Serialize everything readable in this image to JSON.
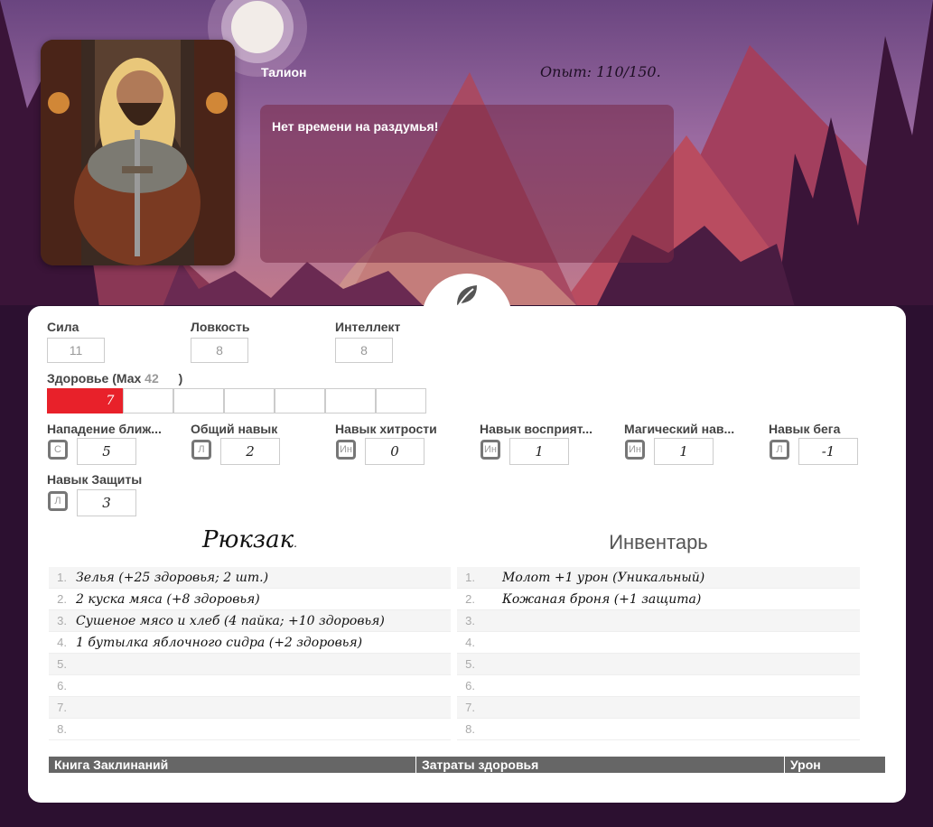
{
  "character": {
    "name": "Талион",
    "experience": "Опыт: 110/150.",
    "speech": "Нет времени на раздумья!"
  },
  "colors": {
    "health_fill": "#e8212a",
    "card_bg": "#ffffff",
    "spell_header_bg": "#666666"
  },
  "icons": {
    "toggle": "leaf-icon"
  },
  "stats": {
    "strength": {
      "label": "Сила",
      "value": "11"
    },
    "agility": {
      "label": "Ловкость",
      "value": "8"
    },
    "intellect": {
      "label": "Интеллект",
      "value": "8"
    }
  },
  "health": {
    "label_prefix": "Здоровье (Мах",
    "max": "42",
    "label_suffix": ")",
    "current": "7",
    "current_fraction": 0.1667
  },
  "skills": [
    {
      "label": "Нападение ближ...",
      "attr": "С",
      "value": "5"
    },
    {
      "label": "Общий навык",
      "attr": "Л",
      "value": "2"
    },
    {
      "label": "Навык хитрости",
      "attr": "Ин",
      "value": "0"
    },
    {
      "label": "Навык восприят...",
      "attr": "Ин",
      "value": "1"
    },
    {
      "label": "Магический нав...",
      "attr": "Ин",
      "value": "1"
    },
    {
      "label": "Навык бега",
      "attr": "Л",
      "value": "-1"
    },
    {
      "label": "Навык Защиты",
      "attr": "Л",
      "value": "3"
    }
  ],
  "backpack": {
    "title": "Рюкзак",
    "title_mark": ".",
    "items": [
      {
        "num": "1.",
        "text": "Зелья (+25 здоровья; 2 шт.)"
      },
      {
        "num": "2.",
        "text": "2 куска мяса (+8 здоровья)"
      },
      {
        "num": "3.",
        "text": "Сушеное мясо и хлеб (4 пайка; +10 здоровья)"
      },
      {
        "num": "4.",
        "text": " 1 бутылка яблочного сидра (+2 здоровья)"
      },
      {
        "num": "5.",
        "text": ""
      },
      {
        "num": "6.",
        "text": ""
      },
      {
        "num": "7.",
        "text": ""
      },
      {
        "num": "8.",
        "text": ""
      }
    ]
  },
  "inventory": {
    "title": "Инвентарь",
    "items": [
      {
        "num": "1.",
        "text": "Молот +1 урон (Уникальный)"
      },
      {
        "num": "2.",
        "text": "Кожаная броня (+1 защита)"
      },
      {
        "num": "3.",
        "text": ""
      },
      {
        "num": "4.",
        "text": ""
      },
      {
        "num": "5.",
        "text": ""
      },
      {
        "num": "6.",
        "text": ""
      },
      {
        "num": "7.",
        "text": ""
      },
      {
        "num": "8.",
        "text": ""
      }
    ]
  },
  "spellbook": {
    "headers": [
      "Книга Заклинаний",
      "Затраты здоровья",
      "Урон"
    ]
  }
}
